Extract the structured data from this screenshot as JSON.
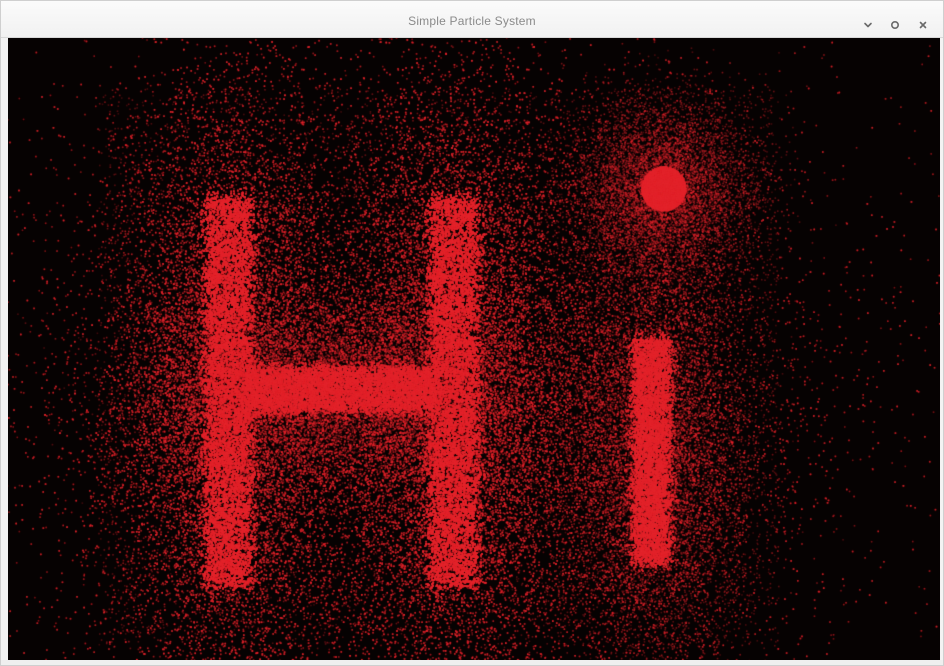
{
  "window": {
    "title": "Simple Particle System"
  },
  "controls": {
    "minimize_icon": "minimize-icon",
    "maximize_icon": "maximize-icon",
    "close_icon": "close-icon"
  },
  "scene": {
    "background_color": "#060202",
    "particle_color": "#e3232b",
    "shape_text": "Hi"
  }
}
